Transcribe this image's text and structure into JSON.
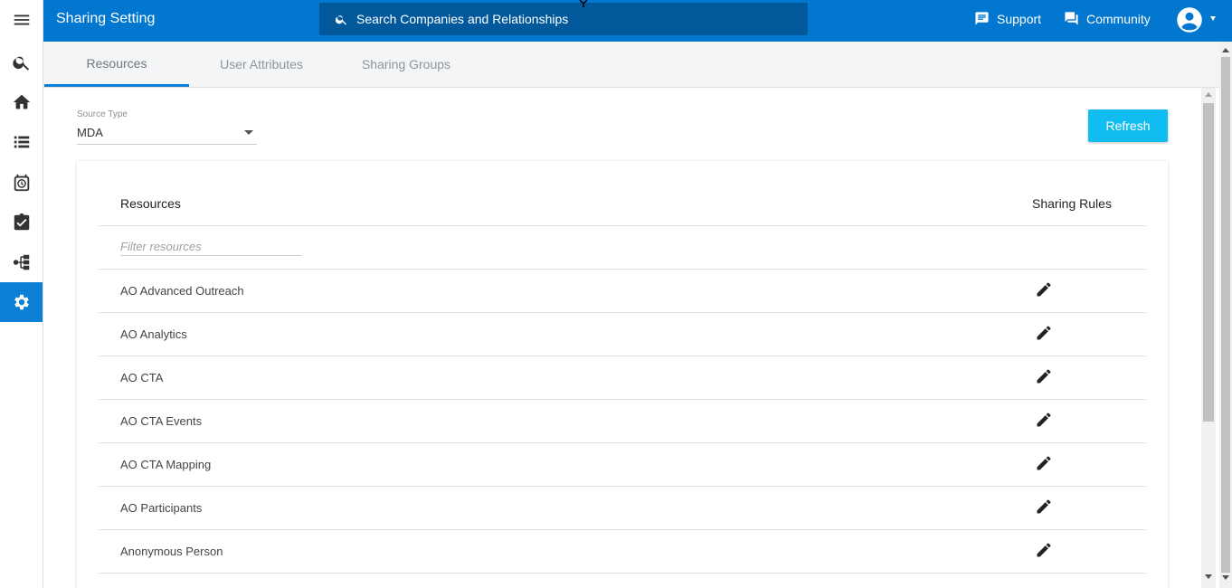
{
  "app": {
    "title": "Sharing Setting"
  },
  "search": {
    "placeholder": "Search Companies and Relationships"
  },
  "header_links": {
    "support": "Support",
    "community": "Community"
  },
  "sidebar": {
    "items": [
      {
        "icon": "menu-icon"
      },
      {
        "icon": "search-icon"
      },
      {
        "icon": "home-icon"
      },
      {
        "icon": "list-icon"
      },
      {
        "icon": "timeline-icon"
      },
      {
        "icon": "tasks-icon"
      },
      {
        "icon": "hierarchy-icon"
      },
      {
        "icon": "gear-icon",
        "active": true
      }
    ]
  },
  "tabs": [
    "Resources",
    "User Attributes",
    "Sharing Groups"
  ],
  "source_type": {
    "label": "Source Type",
    "value": "MDA"
  },
  "refresh_label": "Refresh",
  "table": {
    "col_resources": "Resources",
    "col_sharing_rules": "Sharing Rules",
    "filter_placeholder": "Filter resources",
    "rows": [
      "AO Advanced Outreach",
      "AO Analytics",
      "AO CTA",
      "AO CTA Events",
      "AO CTA Mapping",
      "AO Participants",
      "Anonymous Person"
    ]
  },
  "colors": {
    "topbar": "#0277cf",
    "search_bg": "#01599c",
    "accent": "#0b7fd4",
    "refresh": "#11bdf0"
  }
}
